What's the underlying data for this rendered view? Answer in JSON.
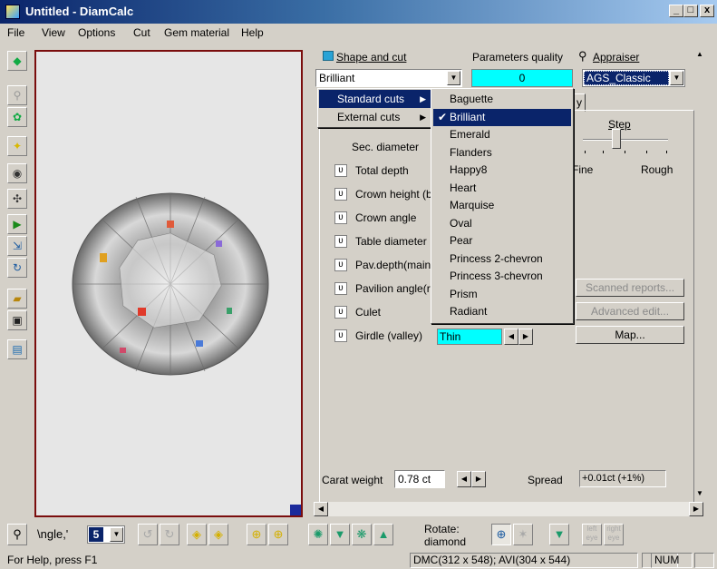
{
  "window": {
    "title": "Untitled - DiamCalc",
    "min": "_",
    "max": "□",
    "close": "x"
  },
  "menubar": [
    "File",
    "View",
    "Options",
    "Cut",
    "Gem material",
    "Help"
  ],
  "panel": {
    "shape_label": "Shape and cut",
    "quality_label": "Parameters quality",
    "appraiser_label": "Appraiser",
    "shape_value": "Brilliant",
    "quality_value": "0",
    "appraiser_value": "AGS_Classic",
    "step_label": "Step",
    "step_fine": "Fine",
    "step_rough": "Rough",
    "params": [
      {
        "label": "Sec. diameter",
        "icon": false
      },
      {
        "label": "Total depth",
        "icon": true
      },
      {
        "label": "Crown height (b",
        "icon": true
      },
      {
        "label": "Crown angle",
        "icon": true
      },
      {
        "label": "Table diameter",
        "icon": true
      },
      {
        "label": "Pav.depth(main",
        "icon": true
      },
      {
        "label": "Pavilion angle(r",
        "icon": true
      },
      {
        "label": "Culet",
        "icon": true
      },
      {
        "label": "Girdle (valley)",
        "icon": true
      }
    ],
    "girdle_value": "Thin",
    "scanned_reports": "Scanned reports...",
    "advanced_edit": "Advanced edit...",
    "map": "Map...",
    "carat_label": "Carat weight",
    "carat_value": "0.78 ct",
    "spread_label": "Spread",
    "spread_value": "+0.01ct (+1%)",
    "tab_fragment": "y"
  },
  "menu_cut": {
    "items": [
      "Standard cuts",
      "External cuts"
    ],
    "selected": 0
  },
  "menu_standard": {
    "items": [
      "Baguette",
      "Brilliant",
      "Emerald",
      "Flanders",
      "Happy8",
      "Heart",
      "Marquise",
      "Oval",
      "Pear",
      "Princess 2-chevron",
      "Princess 3-chevron",
      "Prism",
      "Radiant"
    ],
    "checked": "Brilliant",
    "selected": 1
  },
  "bottom": {
    "angle_label": "\\ngle,'",
    "angle_value": "5",
    "rotate_label": "Rotate:",
    "rotate_value": "diamond",
    "left_eye": "left eye",
    "right_eye": "right eye"
  },
  "status": {
    "help": "For Help, press F1",
    "dims": "DMC(312 x 548); AVI(304 x 544)",
    "num": "NUM"
  }
}
